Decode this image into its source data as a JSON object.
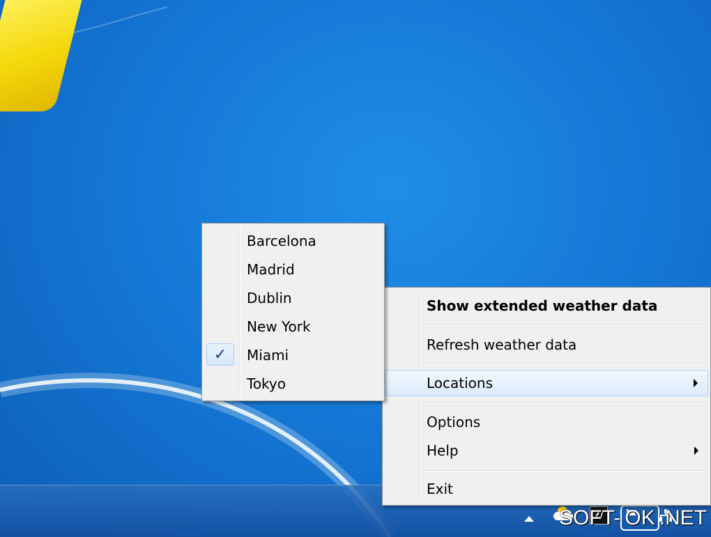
{
  "desktop": {
    "wallpaper": "windows-7-blue"
  },
  "main_menu": {
    "items": [
      {
        "label": "Show extended weather data",
        "bold": true
      },
      {
        "label": "Refresh weather data"
      },
      {
        "label": "Locations",
        "has_submenu": true,
        "highlighted": true
      },
      {
        "label": "Options"
      },
      {
        "label": "Help",
        "has_submenu": true
      },
      {
        "label": "Exit"
      }
    ]
  },
  "locations_submenu": {
    "items": [
      {
        "label": "Barcelona",
        "checked": false
      },
      {
        "label": "Madrid",
        "checked": false
      },
      {
        "label": "Dublin",
        "checked": false
      },
      {
        "label": "New York",
        "checked": false
      },
      {
        "label": "Miami",
        "checked": true
      },
      {
        "label": "Tokyo",
        "checked": false
      }
    ],
    "check_glyph": "✓"
  },
  "taskbar": {
    "tray_icons": [
      "show-hidden-icons-arrow",
      "weather-icon",
      "keyboard-icon",
      "action-center-flag-icon",
      "network-icon"
    ],
    "keyboard_icon_text": "?/"
  },
  "watermark": {
    "prefix": "SOFT-",
    "boxed": "OK",
    "suffix": ".NET"
  },
  "colors": {
    "menu_bg": "#f0f0f0",
    "menu_border": "#979797",
    "highlight_border": "#aecff7",
    "desktop_blue": "#1578d6"
  }
}
